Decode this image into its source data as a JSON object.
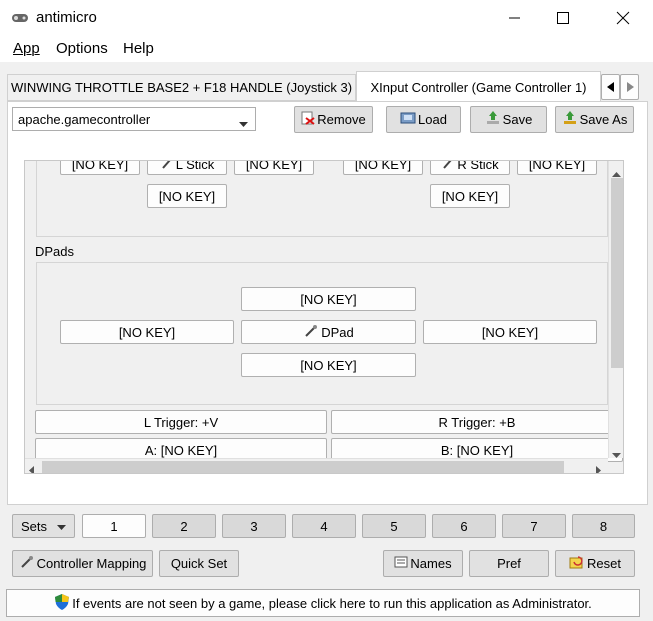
{
  "window": {
    "title": "antimicro"
  },
  "menu": [
    "App",
    "Options",
    "Help"
  ],
  "tabs": [
    "WINWING THROTTLE BASE2 + F18 HANDLE (Joystick 3)",
    "XInput Controller (Game Controller 1)"
  ],
  "toolbar": {
    "profile": "apache.gamecontroller",
    "remove": "Remove",
    "load": "Load",
    "save": "Save",
    "save_as": "Save As"
  },
  "stick_keys": {
    "left_stick": "L Stick",
    "right_stick": "R Stick",
    "no_key": "[NO KEY]"
  },
  "dpads": {
    "heading": "DPads",
    "up": "[NO KEY]",
    "left": "[NO KEY]",
    "center": "DPad",
    "right": "[NO KEY]",
    "down": "[NO KEY]"
  },
  "buttons": {
    "l_trigger": "L Trigger: +V",
    "r_trigger": "R Trigger: +B",
    "a": "A: [NO KEY]",
    "b": "B: [NO KEY]"
  },
  "sets": {
    "label": "Sets",
    "items": [
      "1",
      "2",
      "3",
      "4",
      "5",
      "6",
      "7",
      "8"
    ]
  },
  "bottom": {
    "controller_mapping": "Controller Mapping",
    "quick_set": "Quick Set",
    "names": "Names",
    "pref": "Pref",
    "reset": "Reset"
  },
  "status": "If events are not seen by a game, please click here to run this application as Administrator."
}
